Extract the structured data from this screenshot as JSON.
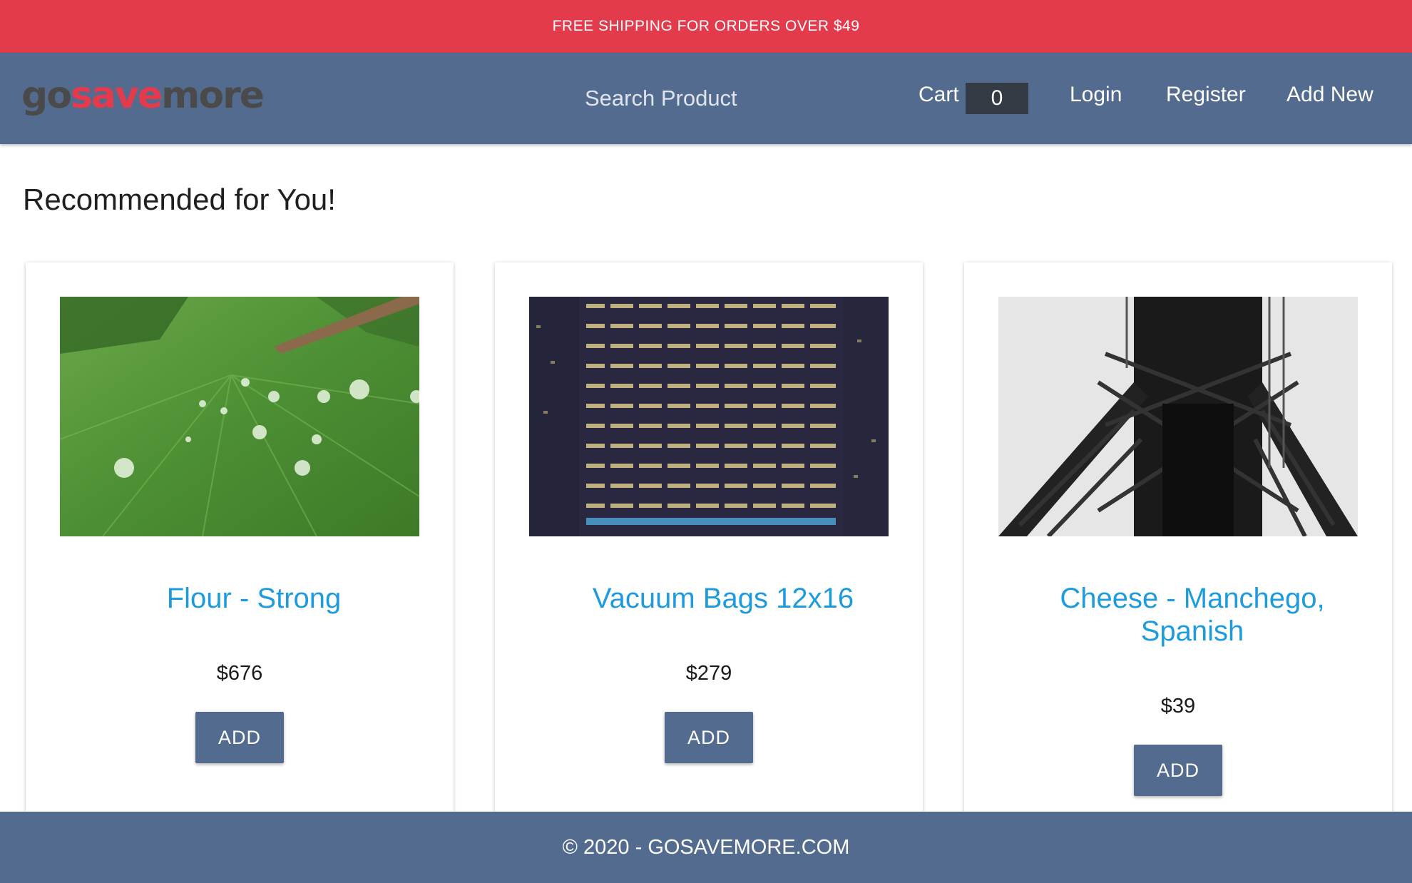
{
  "promo": {
    "text": "FREE SHIPPING FOR ORDERS OVER $49"
  },
  "header": {
    "logo": {
      "part1": "go",
      "part2": "save",
      "part3": "more"
    },
    "search": {
      "placeholder": "Search Product"
    },
    "cart": {
      "label": "Cart",
      "count": "0"
    },
    "links": {
      "login": "Login",
      "register": "Register",
      "add_new": "Add New"
    }
  },
  "main": {
    "title": "Recommended for You!",
    "products": [
      {
        "name": "Flour - Strong",
        "price": "$676",
        "button": "ADD",
        "image": "green-leaf-with-water-drops"
      },
      {
        "name": "Vacuum Bags 12x16",
        "price": "$279",
        "button": "ADD",
        "image": "office-building-at-night"
      },
      {
        "name": "Cheese - Manchego, Spanish",
        "price": "$39",
        "button": "ADD",
        "image": "steel-tower-black-and-white"
      }
    ]
  },
  "footer": {
    "text": "© 2020 - GOSAVEMORE.COM"
  },
  "colors": {
    "promo_bar": "#e33b4b",
    "navbar": "#536b8e",
    "product_title": "#1e9bdc",
    "cart_badge": "#353b44"
  }
}
